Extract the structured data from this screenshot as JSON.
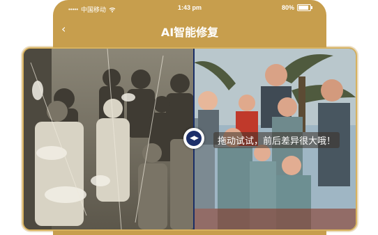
{
  "status_bar": {
    "carrier": "中国移动",
    "signal_dots": "•••••",
    "time": "1:43 pm",
    "battery_text": "80%",
    "battery_level": 0.8
  },
  "nav": {
    "back_icon": "chevron-left-icon",
    "back_glyph": "‹",
    "title": "AI智能修复"
  },
  "compare": {
    "before_label": "",
    "after_label": "",
    "hint": "拖动试试，前后差异很大哦！",
    "handle_glyph": "◀▶",
    "handle_icon": "drag-arrows-icon"
  },
  "colors": {
    "accent": "#c79e4d",
    "divider": "#1a2e66",
    "handle": "#1c2f6a"
  }
}
